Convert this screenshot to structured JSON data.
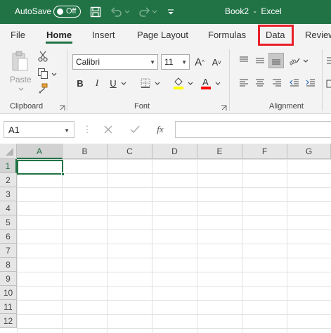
{
  "titlebar": {
    "autosave_label": "AutoSave",
    "autosave_state": "Off",
    "document_title": "Book2  -  Excel"
  },
  "tabs": [
    {
      "label": "File"
    },
    {
      "label": "Home"
    },
    {
      "label": "Insert"
    },
    {
      "label": "Page Layout"
    },
    {
      "label": "Formulas"
    },
    {
      "label": "Data"
    },
    {
      "label": "Review"
    }
  ],
  "active_tab": "Home",
  "highlighted_tab": "Data",
  "ribbon": {
    "clipboard": {
      "label": "Clipboard",
      "paste_label": "Paste"
    },
    "font": {
      "label": "Font",
      "font_name": "Calibri",
      "font_size": "11"
    },
    "alignment": {
      "label": "Alignment"
    }
  },
  "formula_bar": {
    "name_box": "A1",
    "fx_label": "fx",
    "formula": ""
  },
  "grid": {
    "columns": [
      "A",
      "B",
      "C",
      "D",
      "E",
      "F",
      "G"
    ],
    "rows": [
      "1",
      "2",
      "3",
      "4",
      "5",
      "6",
      "7",
      "8",
      "9",
      "10",
      "11",
      "12"
    ],
    "selected_cell": "A1"
  },
  "colors": {
    "excel_green": "#217346",
    "highlight_red": "#e8202a",
    "fill_yellow": "#ffff00",
    "font_red": "#ff0000"
  }
}
